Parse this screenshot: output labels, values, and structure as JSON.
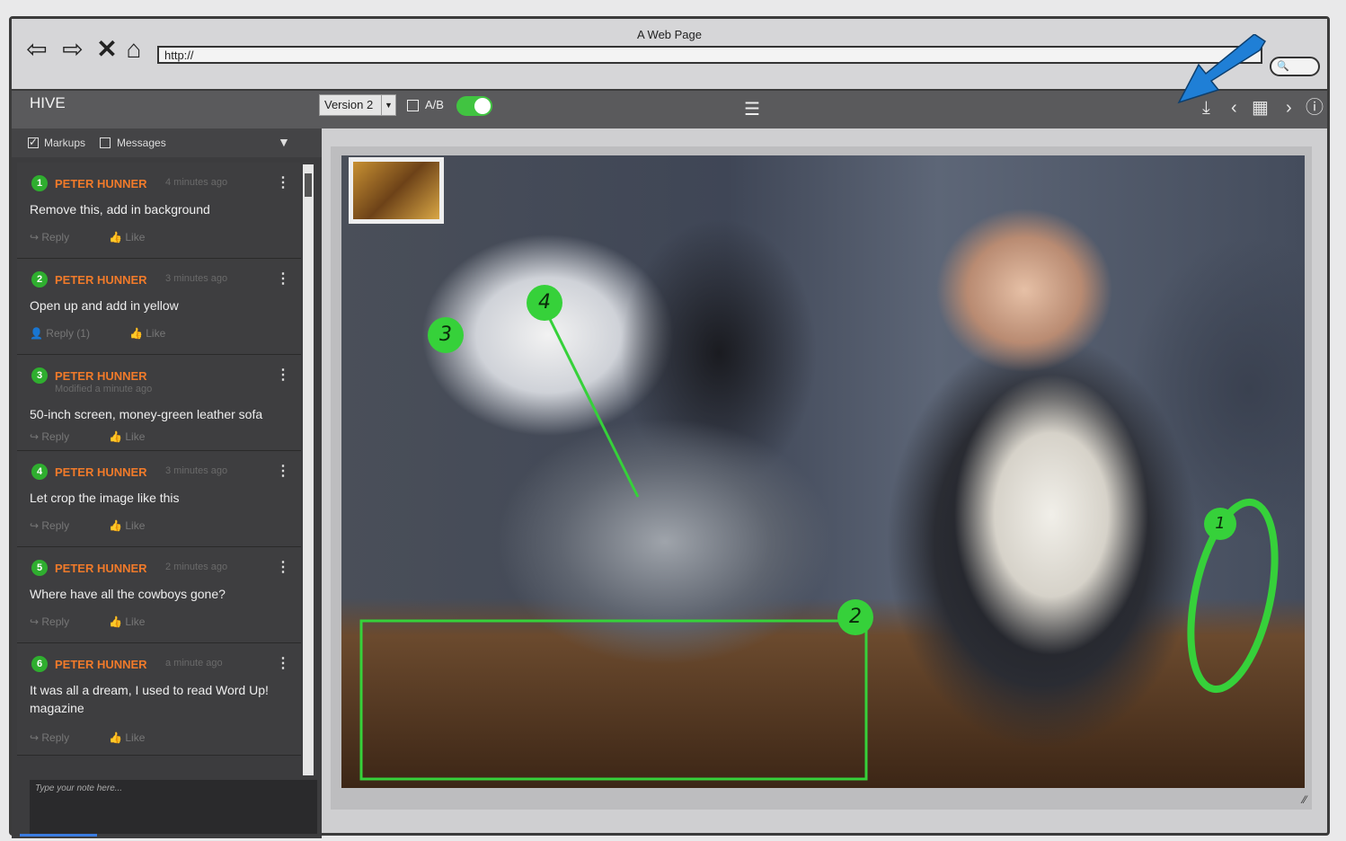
{
  "window": {
    "title": "A Web Page",
    "url": "http://"
  },
  "nav_icons": [
    "back-arrow-icon",
    "forward-arrow-icon",
    "close-icon",
    "home-icon"
  ],
  "toolbar": {
    "app_name": "HIVE",
    "version_selected": "Version 2",
    "ab_label": "A/B",
    "ab_toggle_on": true,
    "right_icons": [
      "download-icon",
      "chevron-left-icon",
      "grid-icon",
      "chevron-right-icon",
      "info-icon"
    ]
  },
  "filters": {
    "markups_label": "Markups",
    "markups_checked": true,
    "messages_label": "Messages",
    "messages_checked": false
  },
  "comments": [
    {
      "num": "1",
      "author": "PETER HUNNER",
      "time": "4 minutes ago",
      "text": "Remove this, add in background",
      "reply": "Reply",
      "like": "Like"
    },
    {
      "num": "2",
      "author": "PETER HUNNER",
      "time": "3 minutes ago",
      "text": "Open up and add in yellow",
      "reply": "Reply (1)",
      "like": "Like"
    },
    {
      "num": "3",
      "author": "PETER HUNNER",
      "time": "Modified a minute ago",
      "text": "50-inch screen, money-green leather sofa",
      "reply": "Reply",
      "like": "Like"
    },
    {
      "num": "4",
      "author": "PETER HUNNER",
      "time": "3 minutes ago",
      "text": "Let crop the image like this",
      "reply": "Reply",
      "like": "Like"
    },
    {
      "num": "5",
      "author": "PETER HUNNER",
      "time": "2 minutes ago",
      "text": "Where have all the cowboys gone?",
      "reply": "Reply",
      "like": "Like"
    },
    {
      "num": "6",
      "author": "PETER HUNNER",
      "time": "a minute ago",
      "text": "It was all a dream, I used to read Word Up! magazine",
      "reply": "Reply",
      "like": "Like"
    }
  ],
  "note_placeholder": "Type your note here...",
  "markers": [
    "1",
    "2",
    "3",
    "4"
  ],
  "colors": {
    "accent_green": "#36d13a",
    "author_orange": "#f07a2a",
    "arrow_blue": "#1f7fd6"
  }
}
